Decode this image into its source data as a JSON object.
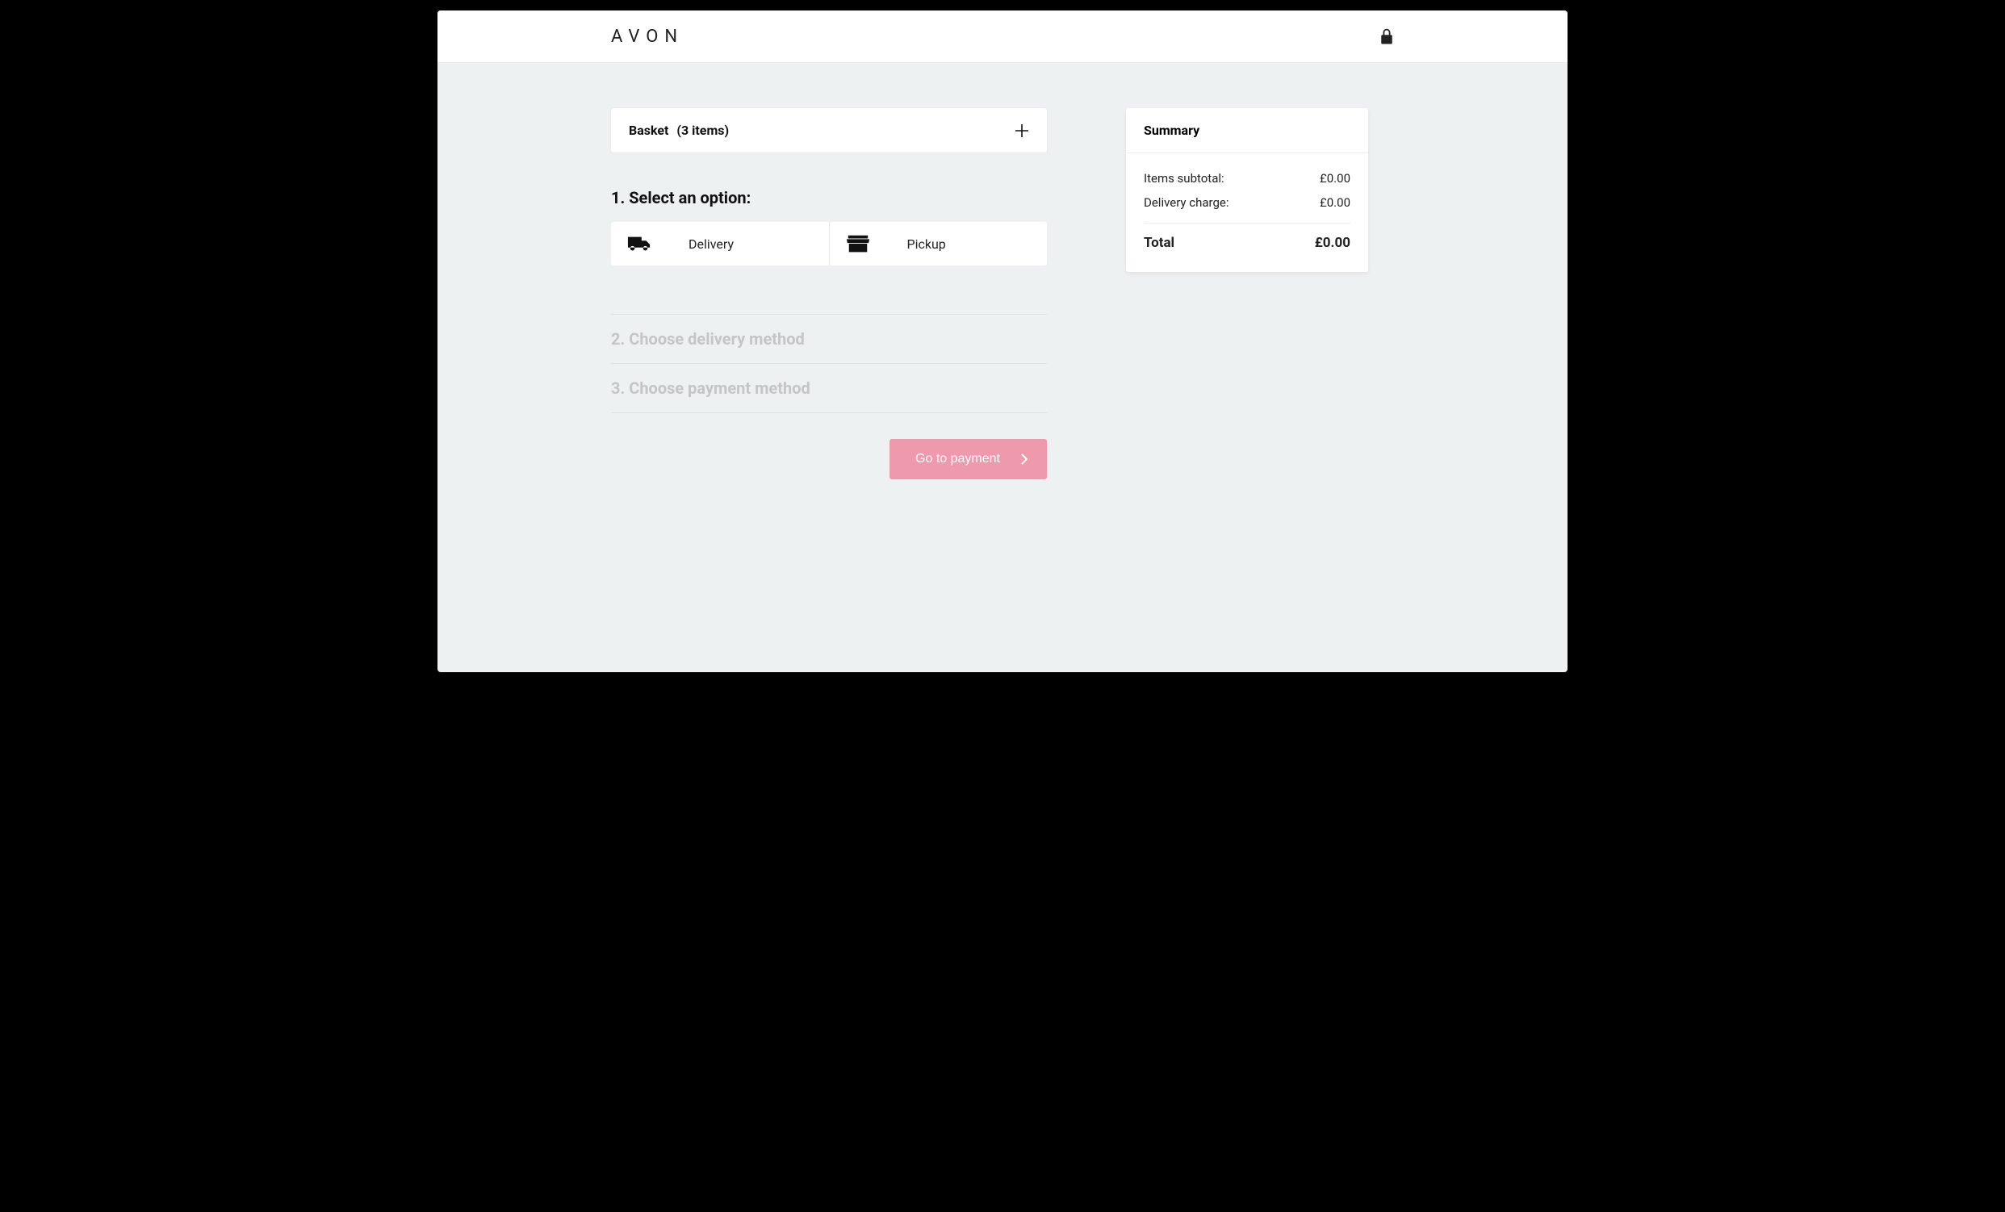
{
  "brand": {
    "name": "AVON"
  },
  "basket": {
    "label": "Basket",
    "count_text": "(3 items)"
  },
  "step1": {
    "title": "1. Select an option:",
    "options": [
      {
        "label": "Delivery"
      },
      {
        "label": "Pickup"
      }
    ]
  },
  "step2": {
    "title": "2. Choose delivery method"
  },
  "step3": {
    "title": "3. Choose payment method"
  },
  "cta": {
    "label": "Go to payment"
  },
  "summary": {
    "title": "Summary",
    "rows": [
      {
        "label": "Items subtotal:",
        "value": "£0.00"
      },
      {
        "label": "Delivery charge:",
        "value": "£0.00"
      }
    ],
    "total_label": "Total",
    "total_value": "£0.00"
  }
}
